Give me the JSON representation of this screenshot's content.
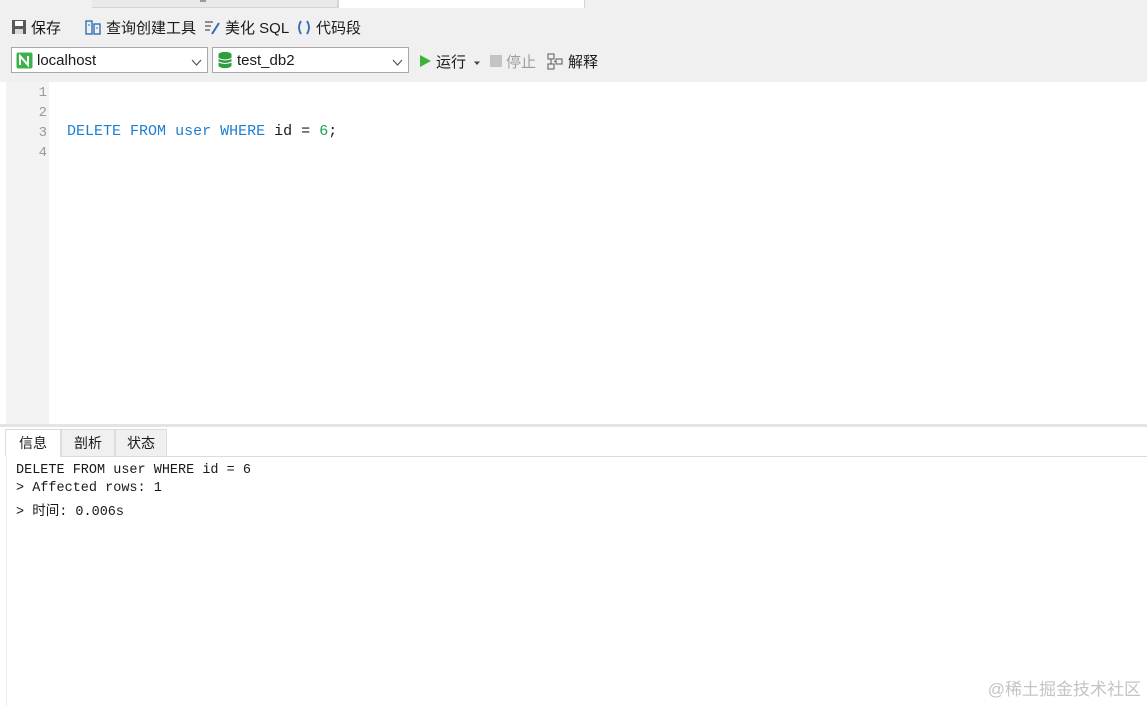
{
  "toolbar": {
    "save_label": "保存",
    "query_builder_label": "查询创建工具",
    "beautify_label": "美化 SQL",
    "snippet_label": "代码段",
    "run_label": "运行",
    "stop_label": "停止",
    "explain_label": "解释"
  },
  "connection": {
    "selected": "localhost"
  },
  "database": {
    "selected": "test_db2"
  },
  "editor": {
    "line_numbers": [
      "1",
      "2",
      "3",
      "4"
    ],
    "code": {
      "kw1": "DELETE",
      "kw2": "FROM",
      "ident": "user",
      "kw3": "WHERE",
      "field": "id",
      "op": "=",
      "value": "6",
      "end": ";"
    }
  },
  "result_tabs": [
    "信息",
    "剖析",
    "状态"
  ],
  "messages": [
    "DELETE FROM user WHERE id = 6",
    "> Affected rows: 1",
    "> 时间: 0.006s"
  ],
  "watermark": "@稀土掘金技术社区",
  "colors": {
    "keyword": "#1e7fd0",
    "number": "#19a34a",
    "run_green": "#3cb43c",
    "db_green": "#2e9e3e"
  }
}
